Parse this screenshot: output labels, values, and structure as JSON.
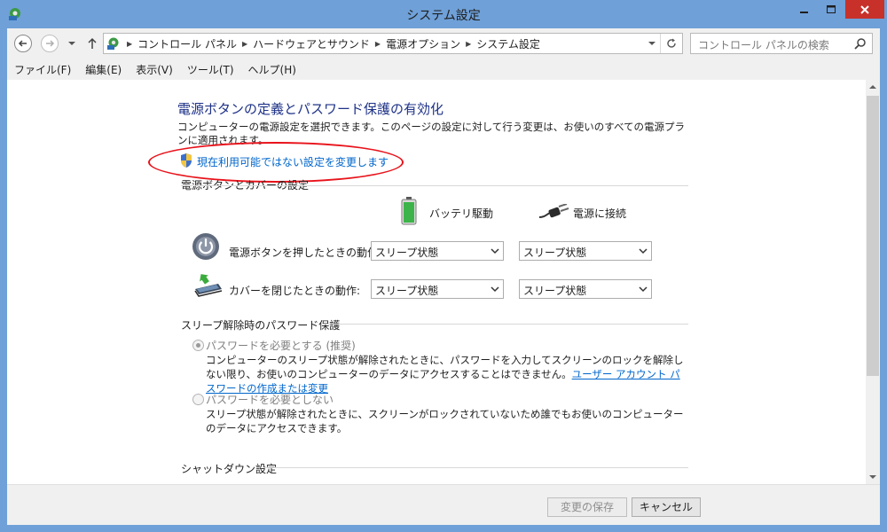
{
  "window": {
    "title": "システム設定"
  },
  "address": {
    "breadcrumbs": [
      "コントロール パネル",
      "ハードウェアとサウンド",
      "電源オプション",
      "システム設定"
    ],
    "search_placeholder": "コントロール パネルの検索"
  },
  "menu": {
    "items": [
      "ファイル(F)",
      "編集(E)",
      "表示(V)",
      "ツール(T)",
      "ヘルプ(H)"
    ]
  },
  "content": {
    "heading": "電源ボタンの定義とパスワード保護の有効化",
    "description": "コンピューターの電源設定を選択できます。このページの設定に対して行う変更は、お使いのすべての電源プランに適用されます。",
    "change_link": "現在利用可能ではない設定を変更します",
    "buttons_section": {
      "title": "電源ボタンとカバーの設定",
      "col_battery": "バッテリ駆動",
      "col_plugged": "電源に接続",
      "rows": [
        {
          "label": "電源ボタンを押したときの動作:",
          "battery": "スリープ状態",
          "plugged": "スリープ状態"
        },
        {
          "label": "カバーを閉じたときの動作:",
          "battery": "スリープ状態",
          "plugged": "スリープ状態"
        }
      ]
    },
    "password_section": {
      "title": "スリープ解除時のパスワード保護",
      "options": [
        {
          "label": "パスワードを必要とする (推奨)",
          "checked": true,
          "desc": "コンピューターのスリープ状態が解除されたときに、パスワードを入力してスクリーンのロックを解除しない限り、お使いのコンピューターのデータにアクセスすることはできません。",
          "link": "ユーザー アカウント パスワードの作成または変更"
        },
        {
          "label": "パスワードを必要としない",
          "checked": false,
          "desc": "スリープ状態が解除されたときに、スクリーンがロックされていないため誰でもお使いのコンピューターのデータにアクセスできます。"
        }
      ]
    },
    "shutdown_section": {
      "title": "シャットダウン設定"
    }
  },
  "footer": {
    "save_label": "変更の保存",
    "cancel_label": "キャンセル"
  },
  "colors": {
    "frame": "#6fa0d8",
    "heading": "#1e3287",
    "link": "#0066cc",
    "highlight": "#e8121a",
    "close": "#c7312a"
  }
}
